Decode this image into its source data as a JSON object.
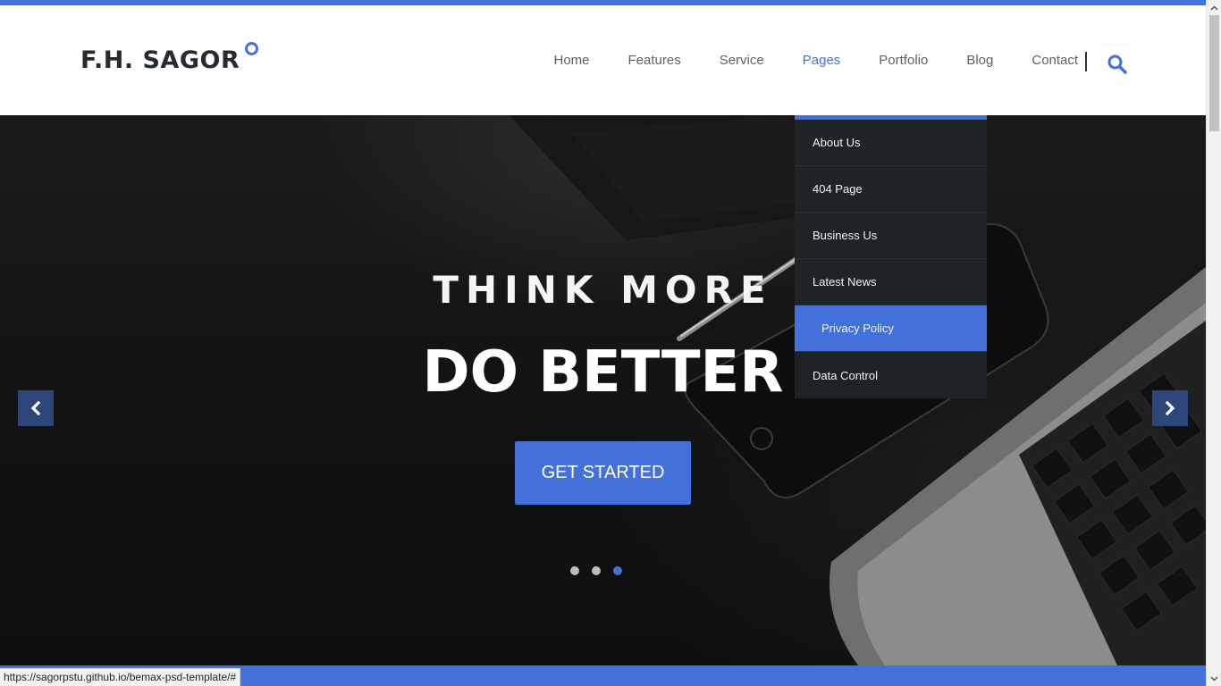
{
  "brand": {
    "logo_text": "F.H. SAGOR",
    "accent_color": "#4471d9"
  },
  "nav": {
    "items": [
      {
        "label": "Home"
      },
      {
        "label": "Features"
      },
      {
        "label": "Service"
      },
      {
        "label": "Pages",
        "active": true
      },
      {
        "label": "Portfolio"
      },
      {
        "label": "Blog"
      },
      {
        "label": "Contact"
      }
    ],
    "search_icon": "search-icon"
  },
  "dropdown": {
    "items": [
      {
        "label": "About Us"
      },
      {
        "label": "404 Page"
      },
      {
        "label": "Business Us"
      },
      {
        "label": "Latest News"
      },
      {
        "label": "Privacy Policy",
        "active": true
      },
      {
        "label": "Data Control"
      }
    ]
  },
  "hero": {
    "title_line1": "THINK MORE",
    "title_line2": "DO BETTER",
    "cta_label": "GET STARTED",
    "slides_count": 3,
    "active_slide": 3,
    "prev_icon": "chevron-left-icon",
    "next_icon": "chevron-right-icon"
  },
  "status_bar": {
    "url": "https://sagorpstu.github.io/bemax-psd-template/#"
  }
}
